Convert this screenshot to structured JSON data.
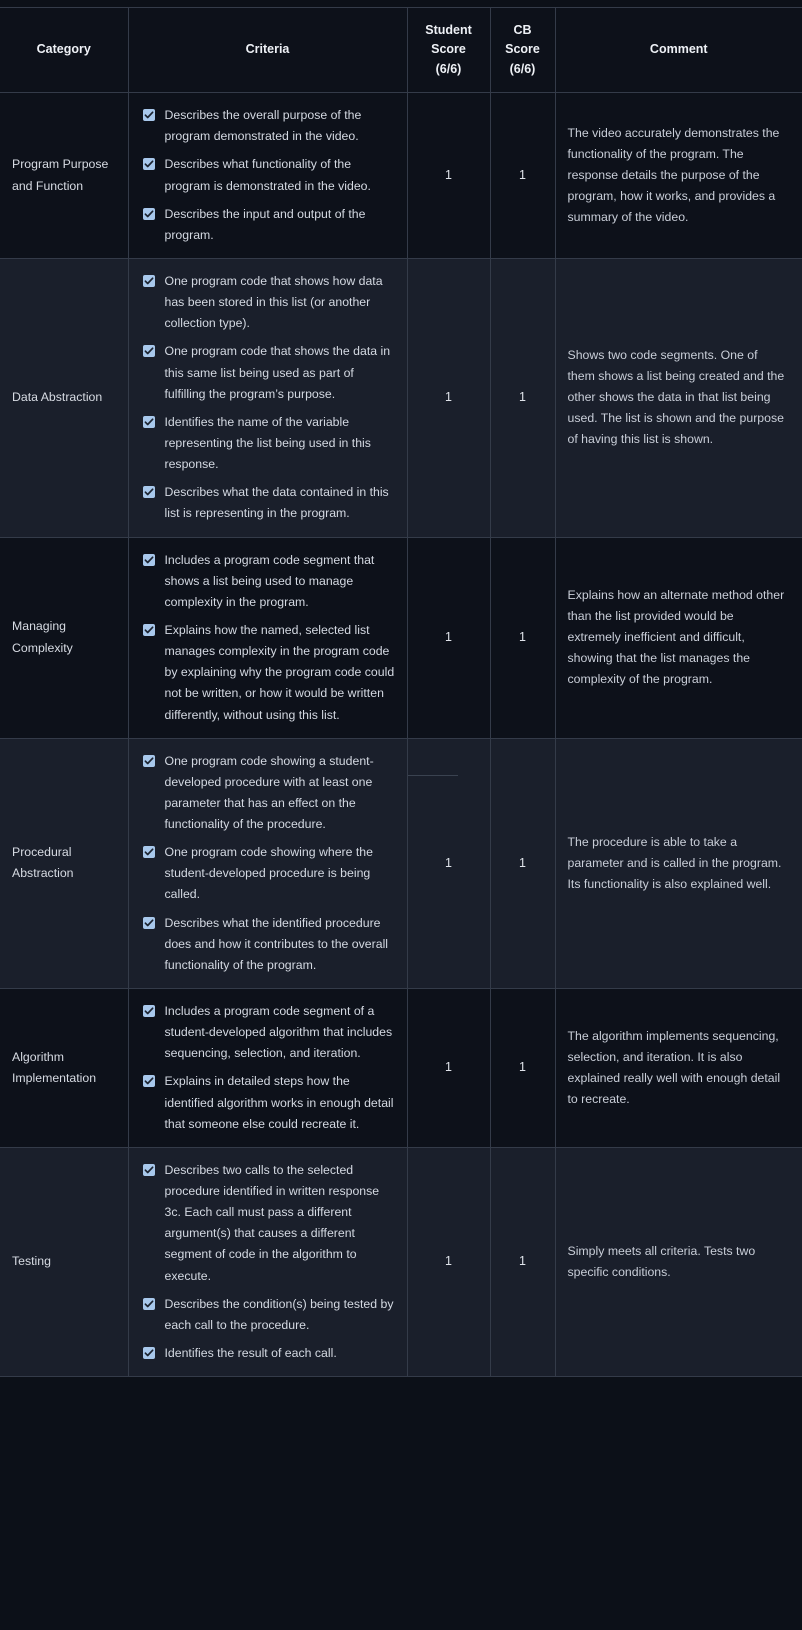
{
  "table": {
    "headers": [
      {
        "label": "Category",
        "lines": [
          "Category"
        ]
      },
      {
        "label": "Criteria",
        "lines": [
          "Criteria"
        ]
      },
      {
        "label": "Student Score (6/6)",
        "lines": [
          "Student",
          "Score",
          "(6/6)"
        ]
      },
      {
        "label": "CB Score (6/6)",
        "lines": [
          "CB",
          "Score",
          "(6/6)"
        ]
      },
      {
        "label": "Comment",
        "lines": [
          "Comment"
        ]
      }
    ],
    "rows": [
      {
        "category": "Program Purpose and Function",
        "criteria": [
          "Describes the overall purpose of the program demonstrated in the video.",
          "Describes what functionality of the program is demonstrated in the video.",
          "Describes the input and output of the program."
        ],
        "student_score": "1",
        "cb_score": "1",
        "comment": "The video accurately demonstrates the functionality of the program. The response details the purpose of the program, how it works, and provides a summary of the video."
      },
      {
        "category": "Data Abstraction",
        "criteria": [
          "One program code that shows how data has been stored in this list (or another collection type).",
          "One program code that shows the data in this same list being used as part of fulfilling the program’s purpose.",
          "Identifies the name of the variable representing the list being used in this response.",
          "Describes what the data contained in this list is representing in the program."
        ],
        "student_score": "1",
        "cb_score": "1",
        "comment": "Shows two code segments. One of them shows a list being created and the other shows the data in that list being used. The list is shown and the purpose of having this list is shown."
      },
      {
        "category": "Managing Complexity",
        "criteria": [
          "Includes a program code segment that shows a list being used to manage complexity in the program.",
          "Explains how the named, selected list manages complexity in the program code by explaining why the program code could not be written, or how it would be written differently, without using this list."
        ],
        "student_score": "1",
        "cb_score": "1",
        "comment": "Explains how an alternate method other than the list provided would be extremely inefficient and difficult, showing that the list manages the complexity of the program."
      },
      {
        "category": "Procedural Abstraction",
        "criteria": [
          "One program code showing a student-developed procedure with at least one parameter that has an effect on the functionality of the procedure.",
          "One program code showing where the student-developed procedure is being called.",
          "Describes what the identified procedure does and how it contributes to the overall functionality of the program."
        ],
        "student_score": "1",
        "cb_score": "1",
        "comment": "The procedure is able to take a parameter and is called in the program. Its functionality is also explained well."
      },
      {
        "category": "Algorithm Implementation",
        "criteria": [
          "Includes a program code segment of a student-developed algorithm that includes sequencing, selection, and iteration.",
          "Explains in detailed steps how the identified algorithm works in enough detail that someone else could recreate it."
        ],
        "student_score": "1",
        "cb_score": "1",
        "comment": "The algorithm implements sequencing, selection, and iteration. It is also explained really well with enough detail to recreate."
      },
      {
        "category": "Testing",
        "criteria": [
          "Describes two calls to the selected procedure identified in written response 3c. Each call must pass a different argument(s) that causes a different segment of code in the algorithm to execute.",
          "Describes the condition(s) being tested by each call to the procedure.",
          "Identifies the result of each call."
        ],
        "student_score": "1",
        "cb_score": "1",
        "comment": "Simply meets all criteria. Tests two specific conditions."
      }
    ]
  },
  "icons": {
    "checkbox_checked": "checkbox-checked-icon"
  },
  "colors": {
    "page_background": "#0c1018",
    "row_dark": "#0d111a",
    "row_light": "#1a1f2b",
    "border": "#343b49",
    "checkbox_fill": "#a8c8ec",
    "checkbox_check": "#1b2330",
    "text_primary": "#e3e6ec",
    "text_body": "#d4d9e2",
    "text_comment": "#c9ced8"
  }
}
